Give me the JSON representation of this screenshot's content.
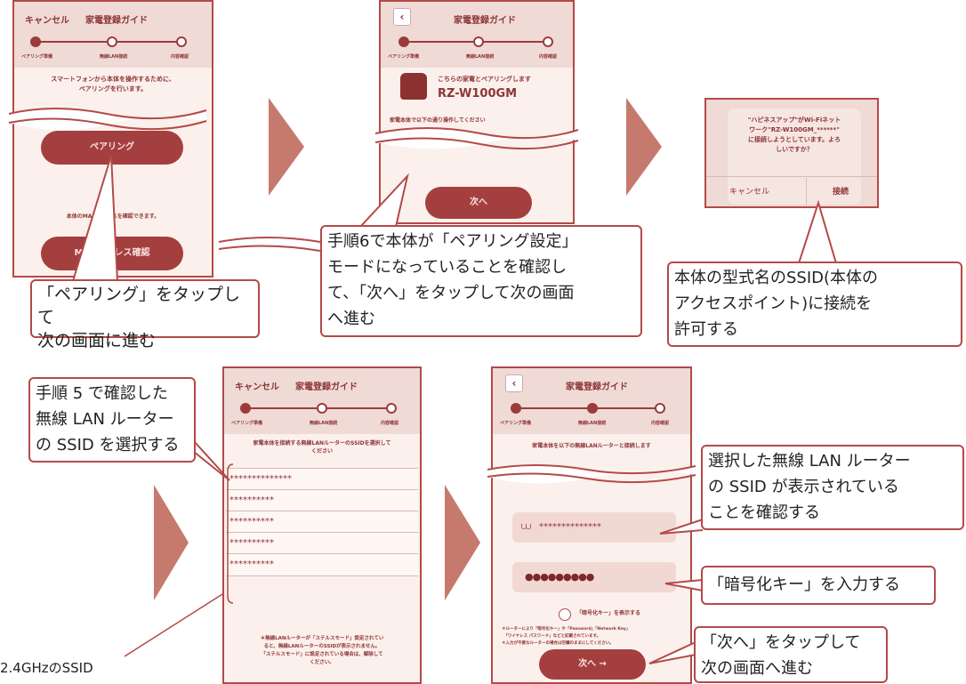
{
  "colors": {
    "accent": "#b34a48",
    "button": "#a43f3f",
    "panel": "#fbf0ec",
    "header": "#efdad6",
    "arrow": "#c67a6e"
  },
  "screen1": {
    "cancel": "キャンセル",
    "title": "家電登録ガイド",
    "steps": [
      "ペアリング準備",
      "無線LAN接続",
      "内容確認"
    ],
    "intro": "スマートフォンから本体を操作するために、\nペアリングを行います。",
    "pair_button": "ペアリング",
    "mac_note": "本体のMACアドレスを確認できます。",
    "mac_button": "MACアドレス確認"
  },
  "callout1": "「ペアリング」をタップして\n次の画面に進む",
  "screen2": {
    "title": "家電登録ガイド",
    "steps": [
      "ペアリング準備",
      "無線LAN接続",
      "内容確認"
    ],
    "pair_msg": "こちらの家電とペアリングします",
    "model": "RZ-W100GM",
    "op_note": "家電本体で以下の通り操作してください",
    "next_button": "次へ"
  },
  "callout2": "手順6で本体が「ペアリング設定」\nモードになっていることを確認し\nて、「次へ」をタップして次の画面\nへ進む",
  "dialog": {
    "message": "\"ハピネスアップ\"がWi-Fiネット\nワーク\"RZ-W100GM_******\"\nに接続しようとしています。よろ\nしいですか？",
    "cancel": "キャンセル",
    "connect": "接続"
  },
  "callout3": "本体の型式名のSSID(本体の\nアクセスポイント)に接続を\n許可する",
  "screen4": {
    "cancel": "キャンセル",
    "title": "家電登録ガイド",
    "steps": [
      "ペアリング準備",
      "無線LAN接続",
      "内容確認"
    ],
    "instruction": "家電本体を接続する無線LANルーターのSSIDを選択して\nください",
    "ssids": [
      "**************",
      "**********",
      "**********",
      "**********",
      "**********"
    ],
    "stealth_note": "＊無線LANルーターが「ステルスモード」設定されてい\nると、無線LANルーターのSSIDが表示されません。\n「ステルスモード」に設定されている場合は、解除して\nください。"
  },
  "callout4": "手順 5 で確認した\n無線 LAN ルーター\nの SSID を選択する",
  "label_24": "2.4GHzのSSID",
  "screen5": {
    "title": "家電登録ガイド",
    "steps": [
      "ペアリング準備",
      "無線LAN接続",
      "内容確認"
    ],
    "instruction": "家電本体を以下の無線LANルーターと接続します",
    "ssid_value": "**************",
    "password_value": "●●●●●●●●●",
    "show_key": "「暗号化キー」を表示する",
    "notes": "＊ルーターにより「暗号化キー」や「Password」「Network Key」\n　「ワイヤレス パスワード」などと記載されています。\n＊入力が不要なルーターの場合は空欄のままにしてください。",
    "next_button": "次へ →"
  },
  "callout5": "選択した無線 LAN ルーター\nの SSID が表示されている\nことを確認する",
  "callout6": "「暗号化キー」を入力する",
  "callout7": "「次へ」をタップして\n次の画面へ進む"
}
